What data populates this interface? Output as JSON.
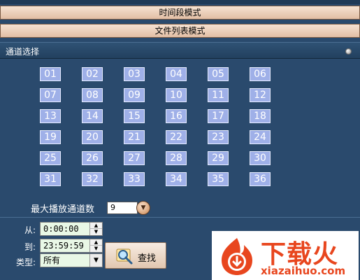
{
  "modes": {
    "time_period": "时间段模式",
    "file_list": "文件列表模式"
  },
  "section": {
    "title": "通道选择"
  },
  "channels": [
    "01",
    "02",
    "03",
    "04",
    "05",
    "06",
    "07",
    "08",
    "09",
    "10",
    "11",
    "12",
    "13",
    "14",
    "15",
    "16",
    "17",
    "18",
    "19",
    "20",
    "21",
    "22",
    "23",
    "24",
    "25",
    "26",
    "27",
    "28",
    "29",
    "30",
    "31",
    "32",
    "33",
    "34",
    "35",
    "36"
  ],
  "max_play": {
    "label": "最大播放通道数",
    "value": "9"
  },
  "filter": {
    "from_label": "从:",
    "from_value": "0:00:00",
    "to_label": "到:",
    "to_value": "23:59:59",
    "type_label": "类型:",
    "type_value": "所有",
    "search_label": "查找"
  },
  "watermark": {
    "brand_cn": "下载火",
    "brand_en": "xiazaihuo.com"
  },
  "colors": {
    "background": "#2a4a6d",
    "channel_button": "#9fb0e8",
    "mode_bar": "#e8c8ae",
    "brand": "#e8461e"
  }
}
